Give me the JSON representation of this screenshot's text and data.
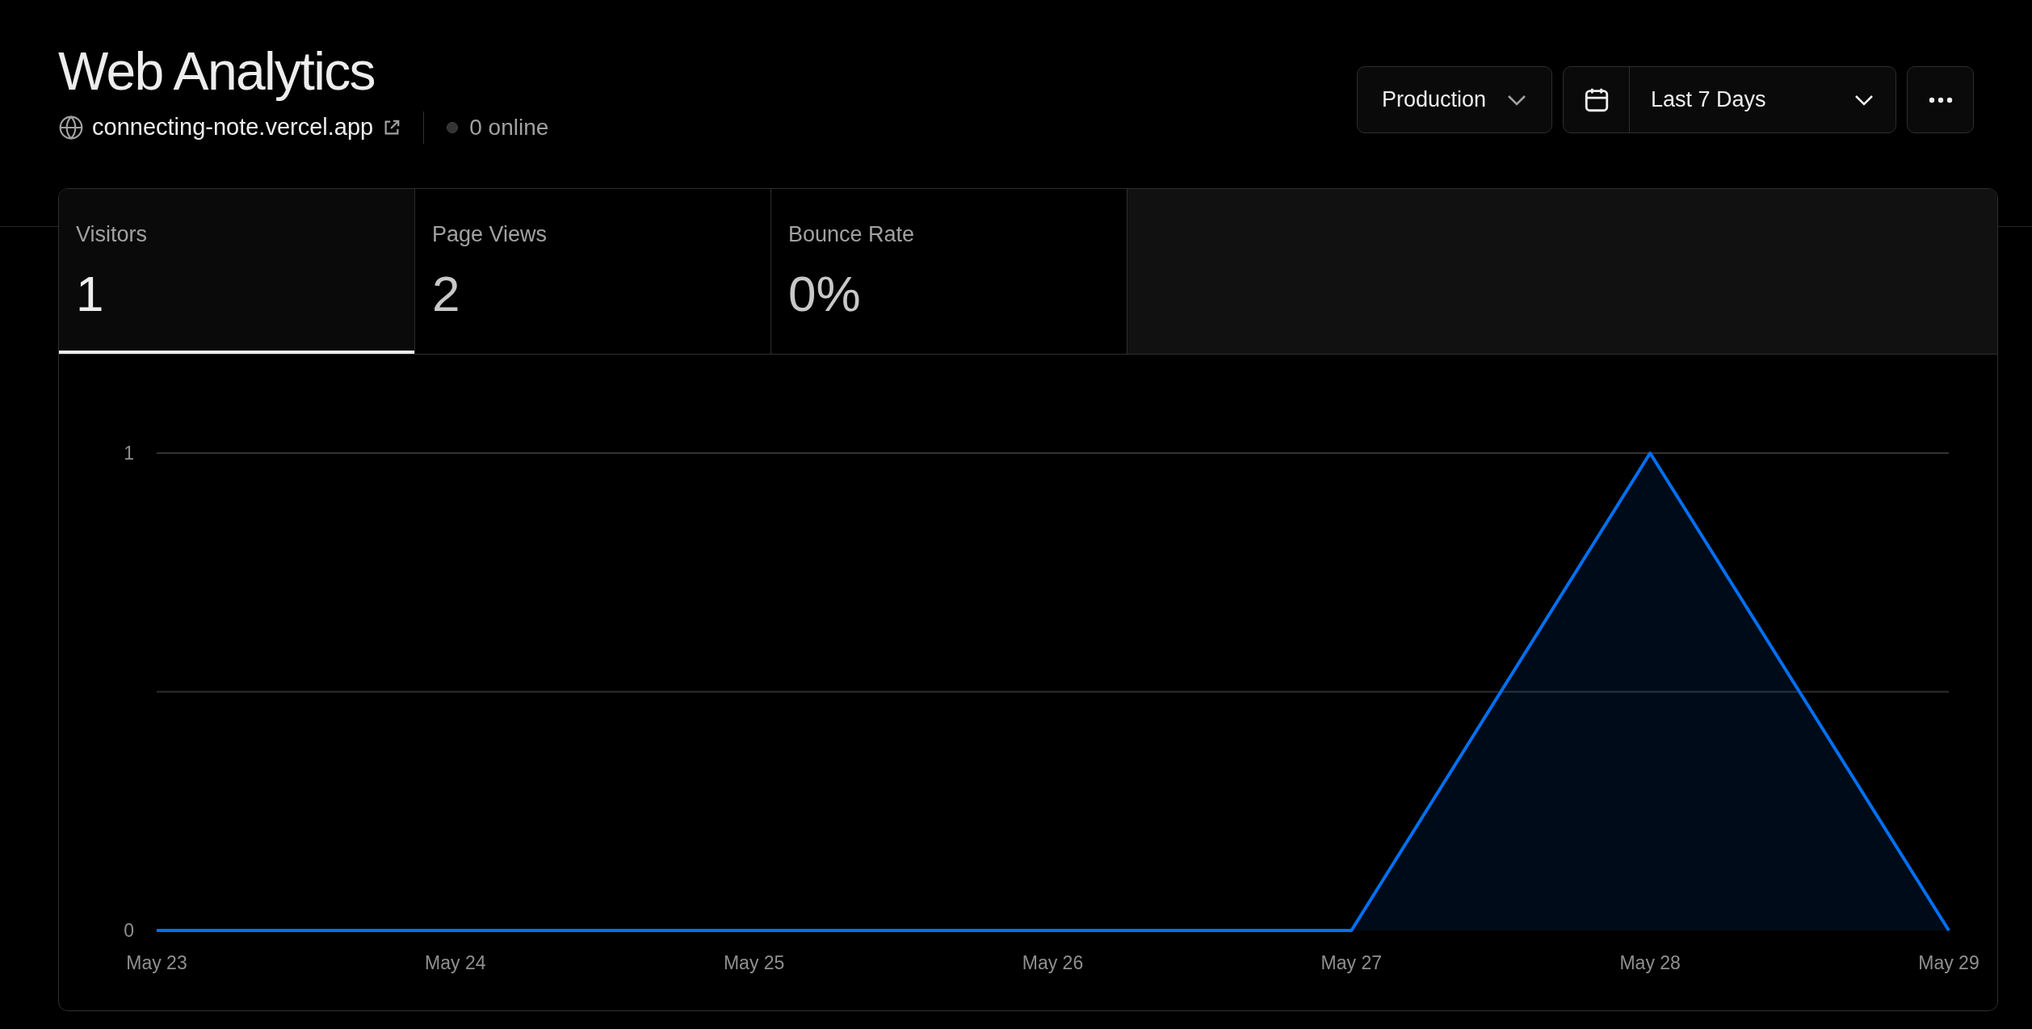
{
  "header": {
    "title": "Web Analytics",
    "domain": "connecting-note.vercel.app",
    "online": "0 online"
  },
  "controls": {
    "environment": "Production",
    "date_range": "Last 7 Days"
  },
  "tabs": [
    {
      "label": "Visitors",
      "value": "1",
      "selected": true
    },
    {
      "label": "Page Views",
      "value": "2",
      "selected": false
    },
    {
      "label": "Bounce Rate",
      "value": "0%",
      "selected": false
    }
  ],
  "chart": {
    "chart_data": {
      "type": "area",
      "x": [
        "May 23",
        "May 24",
        "May 25",
        "May 26",
        "May 27",
        "May 28",
        "May 29"
      ],
      "series": [
        {
          "color": "#0070f3",
          "values": [
            0,
            0,
            0,
            0,
            0,
            1,
            0
          ]
        }
      ],
      "ylim": [
        0,
        1
      ],
      "yticks": [
        0,
        1
      ],
      "ref_lines": [
        {
          "axis": "y",
          "value": 0.5
        }
      ]
    }
  }
}
